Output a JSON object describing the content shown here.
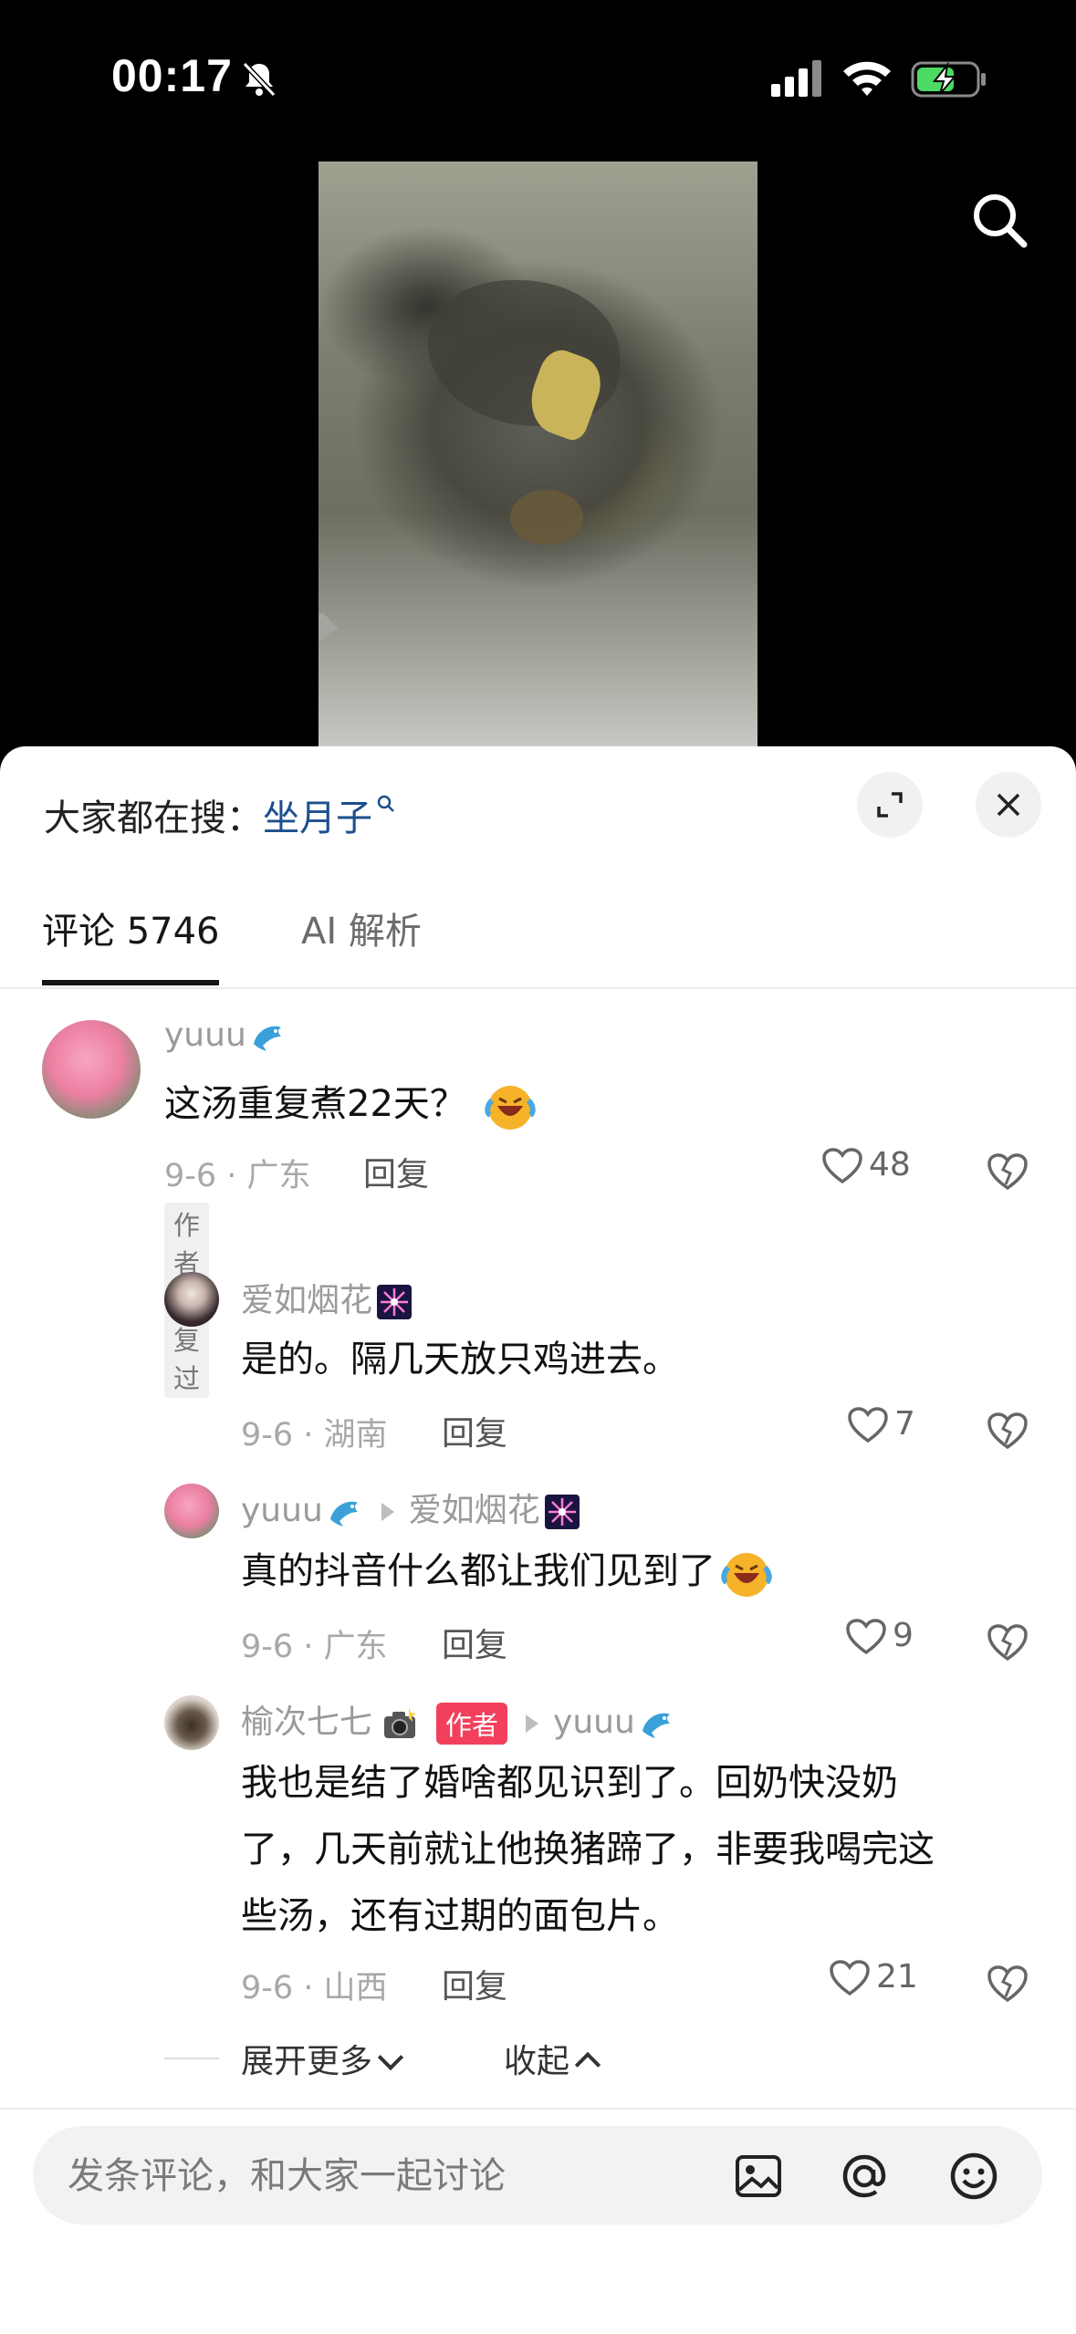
{
  "status_bar": {
    "time": "00:17"
  },
  "hot_search": {
    "prefix": "大家都在搜：",
    "keyword": "坐月子"
  },
  "tabs": {
    "comments": "评论 5746",
    "ai": "AI 解析"
  },
  "comments": [
    {
      "username": "yuuu",
      "text": "这汤重复煮22天？",
      "meta": "9-6 · 广东",
      "reply": "回复",
      "likes": "48",
      "tag": "作者回复过"
    },
    {
      "username": "爱如烟花",
      "text": "是的。隔几天放只鸡进去。",
      "meta": "9-6 · 湖南",
      "reply": "回复",
      "likes": "7"
    },
    {
      "username": "yuuu",
      "reply_to": "爱如烟花",
      "text": "真的抖音什么都让我们见到了",
      "meta": "9-6 · 广东",
      "reply": "回复",
      "likes": "9"
    },
    {
      "username": "榆次七七",
      "author_tag": "作者",
      "reply_to": "yuuu",
      "lines": [
        "我也是结了婚啥都见识到了。回奶快没奶",
        "了，几天前就让他换猪蹄了，非要我喝完这",
        "些汤，还有过期的面包片。"
      ],
      "meta": "9-6 · 山西",
      "reply": "回复",
      "likes": "21"
    }
  ],
  "expand_more": "展开更多",
  "collapse": "收起",
  "input": {
    "placeholder": "发条评论，和大家一起讨论"
  },
  "icons": [
    "bell-slash-icon",
    "signal-icon",
    "wifi-icon",
    "battery-charging-icon",
    "search-icon",
    "expand-icon",
    "close-icon",
    "heart-icon",
    "broken-heart-icon",
    "image-icon",
    "at-icon",
    "emoji-icon",
    "dolphin-emoji-icon",
    "fireworks-emoji-icon",
    "camera-emoji-icon",
    "laughing-crying-emoji-icon"
  ],
  "colors": {
    "author_tag": "#f2405c",
    "keyword_link": "#1c4f8f",
    "battery_fill": "#4cd964"
  }
}
